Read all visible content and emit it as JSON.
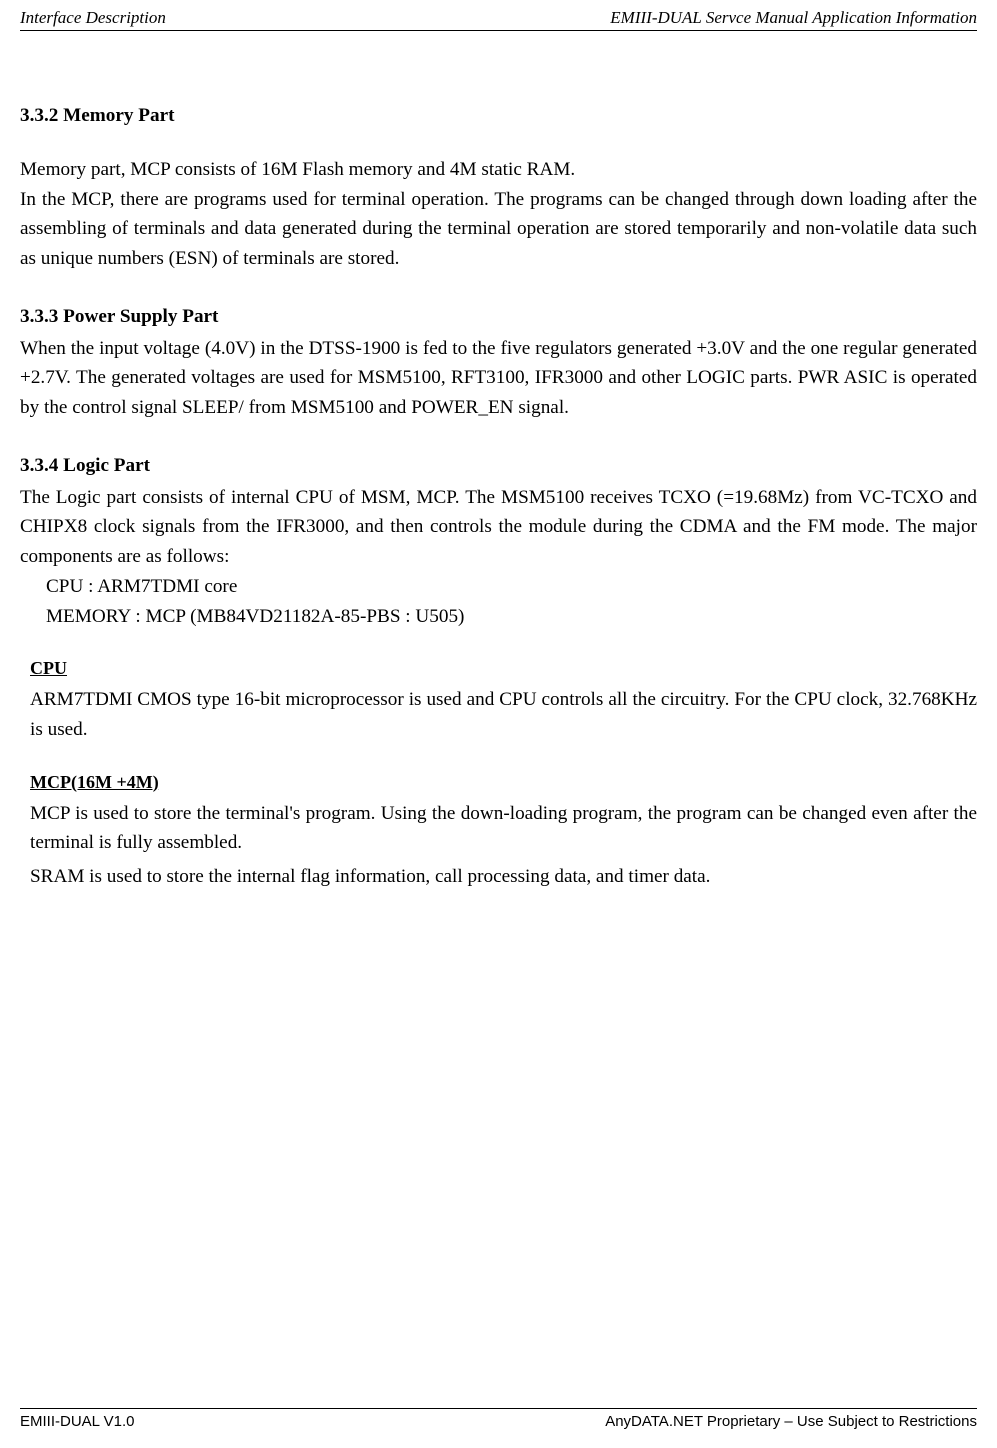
{
  "header": {
    "left": "Interface Description",
    "right": "EMIII-DUAL Servce Manual Application Information"
  },
  "sections": {
    "memory": {
      "heading": "3.3.2 Memory Part",
      "p1": "Memory part, MCP consists of 16M Flash memory and 4M static RAM.",
      "p2": "In the MCP, there are programs used for terminal operation. The programs can be changed through down loading after the assembling of terminals and data generated during the terminal operation are stored temporarily and non-volatile data such as unique numbers (ESN) of terminals are stored."
    },
    "power": {
      "heading": "3.3.3 Power Supply Part",
      "p1": "When the input voltage (4.0V) in the DTSS-1900 is fed to the five regulators generated +3.0V and the one regular generated +2.7V. The generated voltages are used for MSM5100, RFT3100, IFR3000 and other LOGIC parts. PWR ASIC is operated by the control signal SLEEP/ from MSM5100 and POWER_EN signal."
    },
    "logic": {
      "heading": "3.3.4 Logic Part",
      "p1": "The Logic part consists of internal CPU of MSM, MCP. The MSM5100 receives TCXO (=19.68Mz) from VC-TCXO and CHIPX8 clock signals from the IFR3000, and then controls the module during the CDMA and the FM mode. The major components are as follows:",
      "item1": "CPU : ARM7TDMI core",
      "item2": "MEMORY : MCP (MB84VD21182A-85-PBS : U505)",
      "cpu_head": "CPU",
      "cpu_body": "ARM7TDMI CMOS type 16-bit microprocessor is used and CPU controls all the circuitry. For the CPU clock, 32.768KHz is used.",
      "mcp_head": "MCP(16M +4M)",
      "mcp_body1": "MCP is used to store the terminal's program. Using the down-loading program, the program can be changed even after the terminal is fully assembled.",
      "mcp_body2": "SRAM is used to store the internal flag information, call processing data, and timer data."
    }
  },
  "footer": {
    "left": "EMIII-DUAL V1.0",
    "right": "AnyDATA.NET Proprietary –  Use Subject to Restrictions"
  }
}
